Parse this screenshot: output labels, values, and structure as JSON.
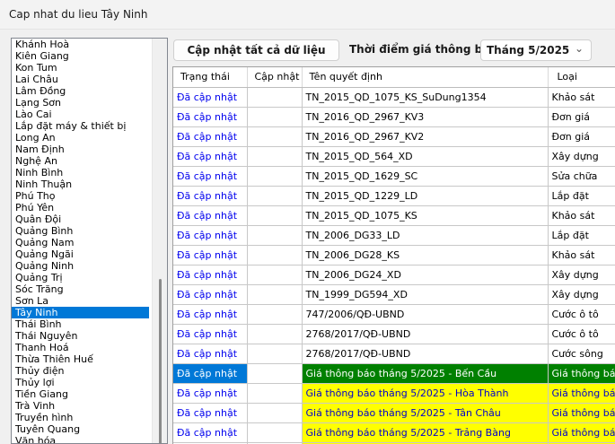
{
  "window": {
    "title": "Cap nhat du lieu Tây Ninh"
  },
  "provinces": {
    "items": [
      "Khánh Hoà",
      "Kiên Giang",
      "Kon Tum",
      "Lai Châu",
      "Lâm Đồng",
      "Lạng Sơn",
      "Lào Cai",
      "Lắp đặt máy & thiết bị",
      "Long An",
      "Nam Định",
      "Nghệ An",
      "Ninh Bình",
      "Ninh Thuận",
      "Phú Thọ",
      "Phú Yên",
      "Quân Đội",
      "Quảng Bình",
      "Quảng Nam",
      "Quảng Ngãi",
      "Quảng Ninh",
      "Quảng Trị",
      "Sóc Trăng",
      "Sơn La",
      "Tây Ninh",
      "Thái Bình",
      "Thái Nguyên",
      "Thanh Hoá",
      "Thừa Thiên Huế",
      "Thủy điện",
      "Thủy lợi",
      "Tiền Giang",
      "Trà Vinh",
      "Truyền hình",
      "Tuyên Quang",
      "Văn hóa"
    ],
    "selected": "Tây Ninh"
  },
  "toolbar": {
    "update_all_label": "Cập nhật tất cả dữ liệu",
    "period_label": "Thời điểm giá thông báo",
    "period_value": "Tháng 5/2025"
  },
  "grid": {
    "headers": [
      "Trạng thái",
      "Cập nhật",
      "Tên quyết định",
      "Loại"
    ],
    "rows": [
      {
        "status": "Đã cập nhật",
        "update": "",
        "decision": "TN_2015_QD_1075_KS_SuDung1354",
        "type": "Khảo sát"
      },
      {
        "status": "Đã cập nhật",
        "update": "",
        "decision": "TN_2016_QD_2967_KV3",
        "type": "Đơn giá"
      },
      {
        "status": "Đã cập nhật",
        "update": "",
        "decision": "TN_2016_QD_2967_KV2",
        "type": "Đơn giá"
      },
      {
        "status": "Đã cập nhật",
        "update": "",
        "decision": "TN_2015_QD_564_XD",
        "type": "Xây dựng"
      },
      {
        "status": "Đã cập nhật",
        "update": "",
        "decision": "TN_2015_QD_1629_SC",
        "type": "Sửa chữa"
      },
      {
        "status": "Đã cập nhật",
        "update": "",
        "decision": "TN_2015_QD_1229_LD",
        "type": "Lắp đặt"
      },
      {
        "status": "Đã cập nhật",
        "update": "",
        "decision": "TN_2015_QD_1075_KS",
        "type": "Khảo sát"
      },
      {
        "status": "Đã cập nhật",
        "update": "",
        "decision": "TN_2006_DG33_LD",
        "type": "Lắp đặt"
      },
      {
        "status": "Đã cập nhật",
        "update": "",
        "decision": "TN_2006_DG28_KS",
        "type": "Khảo sát"
      },
      {
        "status": "Đã cập nhật",
        "update": "",
        "decision": "TN_2006_DG24_XD",
        "type": "Xây dựng"
      },
      {
        "status": "Đã cập nhật",
        "update": "",
        "decision": "TN_1999_DG594_XD",
        "type": "Xây dựng"
      },
      {
        "status": "Đã cập nhật",
        "update": "",
        "decision": "747/2006/QĐ-UBND",
        "type": "Cước ô tô"
      },
      {
        "status": "Đã cập nhật",
        "update": "",
        "decision": "2768/2017/QĐ-UBND",
        "type": "Cước ô tô"
      },
      {
        "status": "Đã cập nhật",
        "update": "",
        "decision": "2768/2017/QĐ-UBND",
        "type": "Cước sông"
      },
      {
        "status": "Đã cập nhật",
        "update": "",
        "decision": "Giá thông báo tháng 5/2025 - Bến Cầu",
        "type": "Giá thông báo",
        "highlight": "green",
        "selected": true
      },
      {
        "status": "Đã cập nhật",
        "update": "",
        "decision": "Giá thông báo tháng 5/2025 - Hòa Thành",
        "type": "Giá thông báo",
        "highlight": "yellow"
      },
      {
        "status": "Đã cập nhật",
        "update": "",
        "decision": "Giá thông báo tháng 5/2025 - Tân Châu",
        "type": "Giá thông báo",
        "highlight": "yellow"
      },
      {
        "status": "Đã cập nhật",
        "update": "",
        "decision": "Giá thông báo tháng 5/2025 - Trảng Bàng",
        "type": "Giá thông báo",
        "highlight": "yellow"
      },
      {
        "status": "",
        "update": "",
        "decision": "",
        "type": "",
        "highlight": "yellow"
      }
    ]
  }
}
